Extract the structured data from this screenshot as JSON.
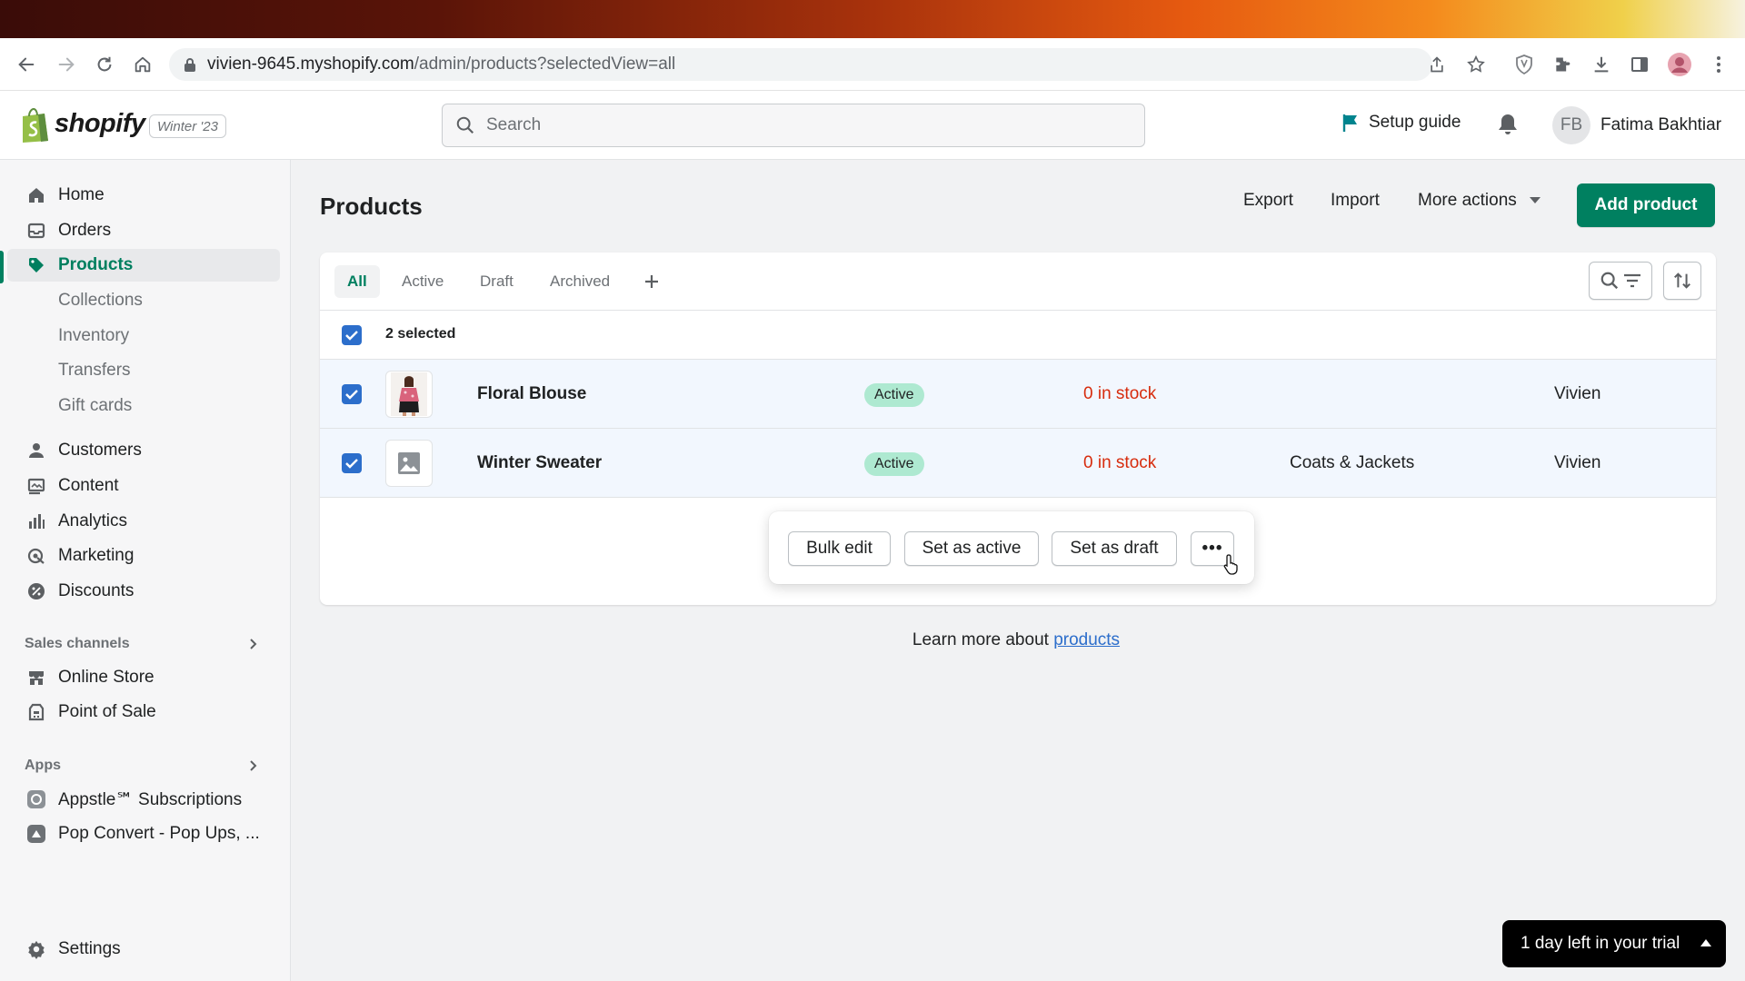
{
  "browser": {
    "url_host": "vivien-9645.myshopify.com",
    "url_path": "/admin/products?selectedView=all"
  },
  "header": {
    "brand": "shopify",
    "edition": "Winter '23",
    "search_placeholder": "Search",
    "setup_guide": "Setup guide",
    "avatar_initials": "FB",
    "user_name": "Fatima Bakhtiar"
  },
  "sidebar": {
    "items": [
      {
        "label": "Home"
      },
      {
        "label": "Orders"
      },
      {
        "label": "Products"
      },
      {
        "label": "Collections"
      },
      {
        "label": "Inventory"
      },
      {
        "label": "Transfers"
      },
      {
        "label": "Gift cards"
      },
      {
        "label": "Customers"
      },
      {
        "label": "Content"
      },
      {
        "label": "Analytics"
      },
      {
        "label": "Marketing"
      },
      {
        "label": "Discounts"
      }
    ],
    "sales_channels_label": "Sales channels",
    "channels": [
      {
        "label": "Online Store"
      },
      {
        "label": "Point of Sale"
      }
    ],
    "apps_label": "Apps",
    "apps": [
      {
        "label": "Appstle℠ Subscriptions"
      },
      {
        "label": "Pop Convert - Pop Ups, ..."
      }
    ],
    "settings": "Settings"
  },
  "main": {
    "title": "Products",
    "export": "Export",
    "import": "Import",
    "more_actions": "More actions",
    "add_product": "Add product",
    "tabs": [
      {
        "label": "All"
      },
      {
        "label": "Active"
      },
      {
        "label": "Draft"
      },
      {
        "label": "Archived"
      }
    ],
    "selected_text": "2 selected",
    "products": [
      {
        "name": "Floral Blouse",
        "status": "Active",
        "inventory": "0 in stock",
        "type": "",
        "vendor": "Vivien"
      },
      {
        "name": "Winter Sweater",
        "status": "Active",
        "inventory": "0 in stock",
        "type": "Coats & Jackets",
        "vendor": "Vivien"
      }
    ],
    "bulk": {
      "bulk_edit": "Bulk edit",
      "set_active": "Set as active",
      "set_draft": "Set as draft",
      "more": "•••"
    },
    "learn_prefix": "Learn more about ",
    "learn_link": "products"
  },
  "trial": "1 day left in your trial",
  "colors": {
    "accent": "#008060",
    "selected_row": "#f2f7fe",
    "badge_active": "#aee9d1",
    "stock_red": "#d72c0d"
  }
}
